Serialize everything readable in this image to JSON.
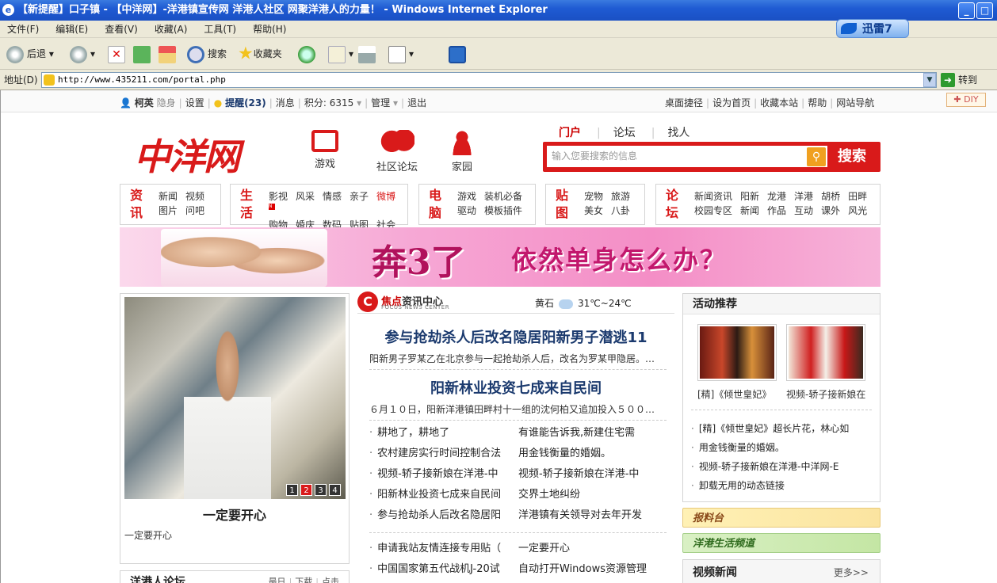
{
  "window": {
    "title": "【新提醒】口子镇 - 【中洋网】-洋港镇宣传网 洋港人社区 网聚洋港人的力量！ - Windows Internet Explorer",
    "min": "_",
    "max": "□",
    "close": "×"
  },
  "menubar": [
    "文件(F)",
    "编辑(E)",
    "查看(V)",
    "收藏(A)",
    "工具(T)",
    "帮助(H)"
  ],
  "xunlei": "迅雷7",
  "toolbar": {
    "back": "后退",
    "search": "搜索",
    "favorites": "收藏夹"
  },
  "address": {
    "label": "地址(D)",
    "url": "http://www.435211.com/portal.php",
    "go": "转到"
  },
  "topinfo": {
    "user": "柯英",
    "status": "隐身",
    "settings": "设置",
    "reminders": "提醒(23)",
    "messages": "消息",
    "points": "积分: 6315",
    "manage": "管理",
    "logout": "退出",
    "right": [
      "桌面捷径",
      "设为首页",
      "收藏本站",
      "帮助",
      "网站导航"
    ],
    "diy": "DIY"
  },
  "logo": "中洋网",
  "channels": [
    {
      "label": "游戏",
      "icon": "tv-icon"
    },
    {
      "label": "社区论坛",
      "icon": "chat-bubbles-icon"
    },
    {
      "label": "家园",
      "icon": "person-icon"
    }
  ],
  "search": {
    "tabs": [
      "门户",
      "论坛",
      "找人"
    ],
    "placeholder": "输入您要搜索的信息",
    "button": "搜索"
  },
  "nav": [
    {
      "big": [
        "资",
        "讯"
      ],
      "rows": [
        [
          "新闻",
          "视频"
        ],
        [
          "图片",
          "问吧"
        ]
      ]
    },
    {
      "big": [
        "生",
        "活"
      ],
      "rows": [
        [
          "影视",
          "风采",
          "情感",
          "亲子",
          "微博"
        ],
        [
          "购物",
          "婚庆",
          "数码",
          "贴图",
          "社会"
        ]
      ]
    },
    {
      "big": [
        "电",
        "脑"
      ],
      "rows": [
        [
          "游戏",
          "装机必备"
        ],
        [
          "驱动",
          "模板插件"
        ]
      ]
    },
    {
      "big": [
        "贴",
        "图"
      ],
      "rows": [
        [
          "宠物",
          "旅游"
        ],
        [
          "美女",
          "八卦"
        ]
      ]
    },
    {
      "big": [
        "论",
        "坛"
      ],
      "rows": [
        [
          "新闻资讯",
          "阳新",
          "龙港",
          "洋港",
          "胡桥",
          "田畔"
        ],
        [
          "校园专区",
          "新闻",
          "作品",
          "互动",
          "课外",
          "风光"
        ]
      ]
    }
  ],
  "banner": {
    "text1": "奔3了",
    "text2": "依然单身怎么办？"
  },
  "feature": {
    "pages": [
      "1",
      "2",
      "3",
      "4"
    ],
    "caption": "一定要开心",
    "desc": "一定要开心"
  },
  "forum_box": {
    "title": "洋港人论坛",
    "tabs": [
      "最日",
      "下载",
      "点击"
    ]
  },
  "focus": {
    "logo": "C",
    "title_red": "焦点",
    "title_rest": "资讯中心",
    "subtitle": "FOCUS NEWS CENTER",
    "weather_place": "黄石",
    "weather_temp": "31℃~24℃"
  },
  "headlines": [
    {
      "title": "参与抢劫杀人后改名隐居阳新男子潜逃11",
      "desc": "阳新男子罗某乙在北京参与一起抢劫杀人后，改名为罗某甲隐居。…"
    },
    {
      "title": "阳新林业投资七成来自民间",
      "desc": "６月１０日，阳新洋港镇田畔村十一组的沈何柏又追加投入５００…"
    }
  ],
  "news_rows": [
    [
      "耕地了，耕地了",
      "有谁能告诉我,新建住宅需"
    ],
    [
      "农村建房实行时间控制合法",
      "用金钱衡量的婚姻。"
    ],
    [
      "视频-轿子接新娘在洋港-中",
      "视频-轿子接新娘在洋港-中"
    ],
    [
      "阳新林业投资七成来自民间",
      "交界土地纠纷"
    ],
    [
      "参与抢劫杀人后改名隐居阳",
      "洋港镇有关领导对去年开发"
    ]
  ],
  "news_rows2": [
    [
      "申请我站友情连接专用贴（",
      "一定要开心"
    ],
    [
      "中国国家第五代战机J-20试",
      "自动打开Windows资源管理"
    ]
  ],
  "activity": {
    "title": "活动推荐",
    "thumbs": [
      "[精]《倾世皇妃》",
      "视频-轿子接新娘在"
    ],
    "list": [
      "[精]《倾世皇妃》超长片花，林心如",
      "用金钱衡量的婚姻。",
      "视频-轿子接新娘在洋港-中洋网-E",
      "卸载无用的动态链接"
    ]
  },
  "side_banners": [
    "报料台",
    "洋港生活频道"
  ],
  "video": {
    "title": "视频新闻",
    "more": "更多>>"
  },
  "colors": {
    "brand_red": "#d91a1a",
    "headline_blue": "#1b3a6e",
    "ie_blue": "#1f5bd3"
  }
}
